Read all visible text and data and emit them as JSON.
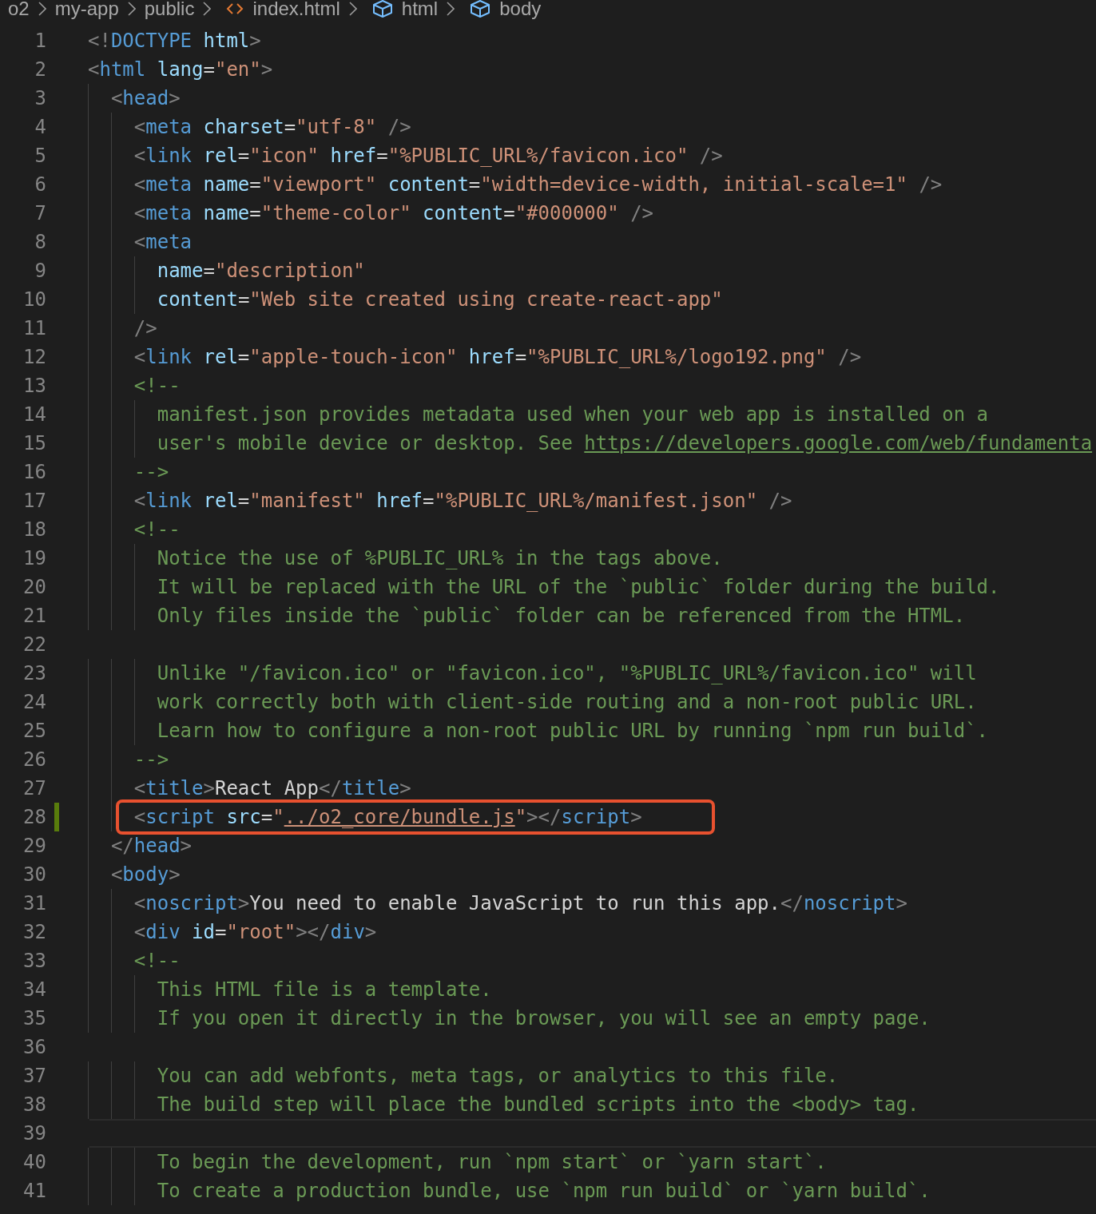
{
  "breadcrumb": [
    {
      "label": "o2",
      "kind": "folder"
    },
    {
      "label": "my-app",
      "kind": "folder"
    },
    {
      "label": "public",
      "kind": "folder"
    },
    {
      "label": "index.html",
      "kind": "file"
    },
    {
      "label": "html",
      "kind": "element"
    },
    {
      "label": "body",
      "kind": "element"
    }
  ],
  "lines": [
    {
      "number": "1",
      "modified": false,
      "current": false,
      "highlighted": false,
      "code": [
        {
          "kind": "p",
          "text": "<!"
        },
        {
          "kind": "tag",
          "text": "DOCTYPE"
        },
        {
          "kind": "attr",
          "text": " html"
        },
        {
          "kind": "p",
          "text": ">"
        }
      ]
    },
    {
      "number": "2",
      "modified": false,
      "current": false,
      "highlighted": false,
      "code": [
        {
          "kind": "p",
          "text": "<"
        },
        {
          "kind": "tag",
          "text": "html"
        },
        {
          "kind": "attr",
          "text": " lang"
        },
        {
          "kind": "txt",
          "text": "="
        },
        {
          "kind": "str",
          "text": "\"en\""
        },
        {
          "kind": "p",
          "text": ">"
        }
      ]
    },
    {
      "number": "3",
      "modified": false,
      "current": false,
      "highlighted": false,
      "code": [
        {
          "kind": "p",
          "text": "  <"
        },
        {
          "kind": "tag",
          "text": "head"
        },
        {
          "kind": "p",
          "text": ">"
        }
      ]
    },
    {
      "number": "4",
      "modified": false,
      "current": false,
      "highlighted": false,
      "code": [
        {
          "kind": "p",
          "text": "    <"
        },
        {
          "kind": "tag",
          "text": "meta"
        },
        {
          "kind": "attr",
          "text": " charset"
        },
        {
          "kind": "txt",
          "text": "="
        },
        {
          "kind": "str",
          "text": "\"utf-8\""
        },
        {
          "kind": "p",
          "text": " />"
        }
      ]
    },
    {
      "number": "5",
      "modified": false,
      "current": false,
      "highlighted": false,
      "code": [
        {
          "kind": "p",
          "text": "    <"
        },
        {
          "kind": "tag",
          "text": "link"
        },
        {
          "kind": "attr",
          "text": " rel"
        },
        {
          "kind": "txt",
          "text": "="
        },
        {
          "kind": "str",
          "text": "\"icon\""
        },
        {
          "kind": "attr",
          "text": " href"
        },
        {
          "kind": "txt",
          "text": "="
        },
        {
          "kind": "str",
          "text": "\"%PUBLIC_URL%/favicon.ico\""
        },
        {
          "kind": "p",
          "text": " />"
        }
      ]
    },
    {
      "number": "6",
      "modified": false,
      "current": false,
      "highlighted": false,
      "code": [
        {
          "kind": "p",
          "text": "    <"
        },
        {
          "kind": "tag",
          "text": "meta"
        },
        {
          "kind": "attr",
          "text": " name"
        },
        {
          "kind": "txt",
          "text": "="
        },
        {
          "kind": "str",
          "text": "\"viewport\""
        },
        {
          "kind": "attr",
          "text": " content"
        },
        {
          "kind": "txt",
          "text": "="
        },
        {
          "kind": "str",
          "text": "\"width=device-width, initial-scale=1\""
        },
        {
          "kind": "p",
          "text": " />"
        }
      ]
    },
    {
      "number": "7",
      "modified": false,
      "current": false,
      "highlighted": false,
      "code": [
        {
          "kind": "p",
          "text": "    <"
        },
        {
          "kind": "tag",
          "text": "meta"
        },
        {
          "kind": "attr",
          "text": " name"
        },
        {
          "kind": "txt",
          "text": "="
        },
        {
          "kind": "str",
          "text": "\"theme-color\""
        },
        {
          "kind": "attr",
          "text": " content"
        },
        {
          "kind": "txt",
          "text": "="
        },
        {
          "kind": "str",
          "text": "\"#000000\""
        },
        {
          "kind": "p",
          "text": " />"
        }
      ]
    },
    {
      "number": "8",
      "modified": false,
      "current": false,
      "highlighted": false,
      "code": [
        {
          "kind": "p",
          "text": "    <"
        },
        {
          "kind": "tag",
          "text": "meta"
        }
      ]
    },
    {
      "number": "9",
      "modified": false,
      "current": false,
      "highlighted": false,
      "code": [
        {
          "kind": "attr",
          "text": "      name"
        },
        {
          "kind": "txt",
          "text": "="
        },
        {
          "kind": "str",
          "text": "\"description\""
        }
      ]
    },
    {
      "number": "10",
      "modified": false,
      "current": false,
      "highlighted": false,
      "code": [
        {
          "kind": "attr",
          "text": "      content"
        },
        {
          "kind": "txt",
          "text": "="
        },
        {
          "kind": "str",
          "text": "\"Web site created using create-react-app\""
        }
      ]
    },
    {
      "number": "11",
      "modified": false,
      "current": false,
      "highlighted": false,
      "code": [
        {
          "kind": "p",
          "text": "    />"
        }
      ]
    },
    {
      "number": "12",
      "modified": false,
      "current": false,
      "highlighted": false,
      "code": [
        {
          "kind": "p",
          "text": "    <"
        },
        {
          "kind": "tag",
          "text": "link"
        },
        {
          "kind": "attr",
          "text": " rel"
        },
        {
          "kind": "txt",
          "text": "="
        },
        {
          "kind": "str",
          "text": "\"apple-touch-icon\""
        },
        {
          "kind": "attr",
          "text": " href"
        },
        {
          "kind": "txt",
          "text": "="
        },
        {
          "kind": "str",
          "text": "\"%PUBLIC_URL%/logo192.png\""
        },
        {
          "kind": "p",
          "text": " />"
        }
      ]
    },
    {
      "number": "13",
      "modified": false,
      "current": false,
      "highlighted": false,
      "code": [
        {
          "kind": "com",
          "text": "    <!--"
        }
      ]
    },
    {
      "number": "14",
      "modified": false,
      "current": false,
      "highlighted": false,
      "code": [
        {
          "kind": "com",
          "text": "      manifest.json provides metadata used when your web app is installed on a"
        }
      ]
    },
    {
      "number": "15",
      "modified": false,
      "current": false,
      "highlighted": false,
      "code": [
        {
          "kind": "com",
          "text": "      user's mobile device or desktop. See "
        },
        {
          "kind": "comlink",
          "text": "https://developers.google.com/web/fundamenta"
        }
      ]
    },
    {
      "number": "16",
      "modified": false,
      "current": false,
      "highlighted": false,
      "code": [
        {
          "kind": "com",
          "text": "    -->"
        }
      ]
    },
    {
      "number": "17",
      "modified": false,
      "current": false,
      "highlighted": false,
      "code": [
        {
          "kind": "p",
          "text": "    <"
        },
        {
          "kind": "tag",
          "text": "link"
        },
        {
          "kind": "attr",
          "text": " rel"
        },
        {
          "kind": "txt",
          "text": "="
        },
        {
          "kind": "str",
          "text": "\"manifest\""
        },
        {
          "kind": "attr",
          "text": " href"
        },
        {
          "kind": "txt",
          "text": "="
        },
        {
          "kind": "str",
          "text": "\"%PUBLIC_URL%/manifest.json\""
        },
        {
          "kind": "p",
          "text": " />"
        }
      ]
    },
    {
      "number": "18",
      "modified": false,
      "current": false,
      "highlighted": false,
      "code": [
        {
          "kind": "com",
          "text": "    <!--"
        }
      ]
    },
    {
      "number": "19",
      "modified": false,
      "current": false,
      "highlighted": false,
      "code": [
        {
          "kind": "com",
          "text": "      Notice the use of %PUBLIC_URL% in the tags above."
        }
      ]
    },
    {
      "number": "20",
      "modified": false,
      "current": false,
      "highlighted": false,
      "code": [
        {
          "kind": "com",
          "text": "      It will be replaced with the URL of the `public` folder during the build."
        }
      ]
    },
    {
      "number": "21",
      "modified": false,
      "current": false,
      "highlighted": false,
      "code": [
        {
          "kind": "com",
          "text": "      Only files inside the `public` folder can be referenced from the HTML."
        }
      ]
    },
    {
      "number": "22",
      "modified": false,
      "current": false,
      "highlighted": false
    },
    {
      "number": "23",
      "modified": false,
      "current": false,
      "highlighted": false,
      "code": [
        {
          "kind": "com",
          "text": "      Unlike \"/favicon.ico\" or \"favicon.ico\", \"%PUBLIC_URL%/favicon.ico\" will"
        }
      ]
    },
    {
      "number": "24",
      "modified": false,
      "current": false,
      "highlighted": false,
      "code": [
        {
          "kind": "com",
          "text": "      work correctly both with client-side routing and a non-root public URL."
        }
      ]
    },
    {
      "number": "25",
      "modified": false,
      "current": false,
      "highlighted": false,
      "code": [
        {
          "kind": "com",
          "text": "      Learn how to configure a non-root public URL by running `npm run build`."
        }
      ]
    },
    {
      "number": "26",
      "modified": false,
      "current": false,
      "highlighted": false,
      "code": [
        {
          "kind": "com",
          "text": "    -->"
        }
      ]
    },
    {
      "number": "27",
      "modified": false,
      "current": false,
      "highlighted": false,
      "code": [
        {
          "kind": "p",
          "text": "    <"
        },
        {
          "kind": "tag",
          "text": "title"
        },
        {
          "kind": "p",
          "text": ">"
        },
        {
          "kind": "txt",
          "text": "React App"
        },
        {
          "kind": "p",
          "text": "</"
        },
        {
          "kind": "tag",
          "text": "title"
        },
        {
          "kind": "p",
          "text": ">"
        }
      ]
    },
    {
      "number": "28",
      "modified": true,
      "current": false,
      "highlighted": true,
      "code": [
        {
          "kind": "p",
          "text": "    <"
        },
        {
          "kind": "tag",
          "text": "script"
        },
        {
          "kind": "attr",
          "text": " src"
        },
        {
          "kind": "txt",
          "text": "="
        },
        {
          "kind": "str",
          "text": "\""
        },
        {
          "kind": "strlink",
          "text": "../o2_core/bundle.js"
        },
        {
          "kind": "str",
          "text": "\""
        },
        {
          "kind": "p",
          "text": "></"
        },
        {
          "kind": "tag",
          "text": "script"
        },
        {
          "kind": "p",
          "text": ">"
        }
      ]
    },
    {
      "number": "29",
      "modified": false,
      "current": false,
      "highlighted": false,
      "code": [
        {
          "kind": "p",
          "text": "  </"
        },
        {
          "kind": "tag",
          "text": "head"
        },
        {
          "kind": "p",
          "text": ">"
        }
      ]
    },
    {
      "number": "30",
      "modified": false,
      "current": false,
      "highlighted": false,
      "code": [
        {
          "kind": "p",
          "text": "  <"
        },
        {
          "kind": "tag",
          "text": "body"
        },
        {
          "kind": "p",
          "text": ">"
        }
      ]
    },
    {
      "number": "31",
      "modified": false,
      "current": false,
      "highlighted": false,
      "code": [
        {
          "kind": "p",
          "text": "    <"
        },
        {
          "kind": "tag",
          "text": "noscript"
        },
        {
          "kind": "p",
          "text": ">"
        },
        {
          "kind": "txt",
          "text": "You need to enable JavaScript to run this app."
        },
        {
          "kind": "p",
          "text": "</"
        },
        {
          "kind": "tag",
          "text": "noscript"
        },
        {
          "kind": "p",
          "text": ">"
        }
      ]
    },
    {
      "number": "32",
      "modified": false,
      "current": false,
      "highlighted": false,
      "code": [
        {
          "kind": "p",
          "text": "    <"
        },
        {
          "kind": "tag",
          "text": "div"
        },
        {
          "kind": "attr",
          "text": " id"
        },
        {
          "kind": "txt",
          "text": "="
        },
        {
          "kind": "str",
          "text": "\"root\""
        },
        {
          "kind": "p",
          "text": "></"
        },
        {
          "kind": "tag",
          "text": "div"
        },
        {
          "kind": "p",
          "text": ">"
        }
      ]
    },
    {
      "number": "33",
      "modified": false,
      "current": false,
      "highlighted": false,
      "code": [
        {
          "kind": "com",
          "text": "    <!--"
        }
      ]
    },
    {
      "number": "34",
      "modified": false,
      "current": false,
      "highlighted": false,
      "code": [
        {
          "kind": "com",
          "text": "      This HTML file is a template."
        }
      ]
    },
    {
      "number": "35",
      "modified": false,
      "current": false,
      "highlighted": false,
      "code": [
        {
          "kind": "com",
          "text": "      If you open it directly in the browser, you will see an empty page."
        }
      ]
    },
    {
      "number": "36",
      "modified": false,
      "current": false,
      "highlighted": false
    },
    {
      "number": "37",
      "modified": false,
      "current": false,
      "highlighted": false,
      "code": [
        {
          "kind": "com",
          "text": "      You can add webfonts, meta tags, or analytics to this file."
        }
      ]
    },
    {
      "number": "38",
      "modified": false,
      "current": false,
      "highlighted": false,
      "code": [
        {
          "kind": "com",
          "text": "      The build step will place the bundled scripts into the <body> tag."
        }
      ]
    },
    {
      "number": "39",
      "modified": false,
      "current": true,
      "highlighted": false
    },
    {
      "number": "40",
      "modified": false,
      "current": false,
      "highlighted": false,
      "code": [
        {
          "kind": "com",
          "text": "      To begin the development, run `npm start` or `yarn start`."
        }
      ]
    },
    {
      "number": "41",
      "modified": false,
      "current": false,
      "highlighted": false,
      "code": [
        {
          "kind": "com",
          "text": "      To create a production bundle, use `npm run build` or `yarn build`."
        }
      ]
    }
  ]
}
